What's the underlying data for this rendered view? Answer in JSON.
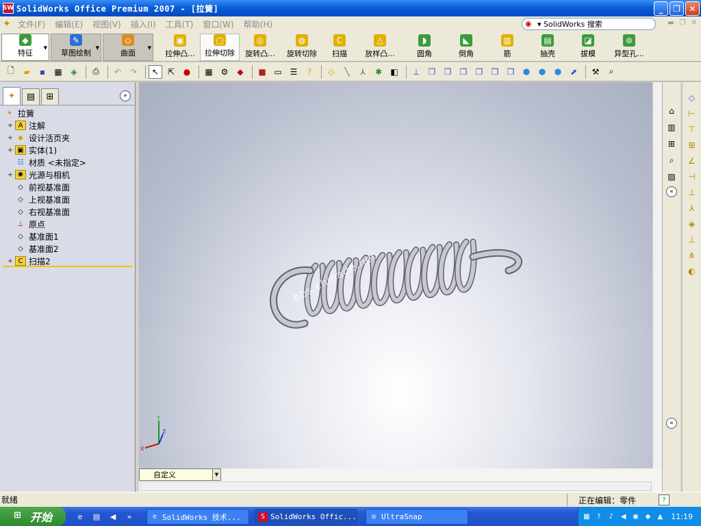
{
  "window": {
    "title": "SolidWorks Office Premium 2007 - [拉簧]",
    "logo_text": "SW",
    "min": "_",
    "restore": "❐",
    "close": "✕"
  },
  "menu": {
    "items": [
      "文件(F)",
      "编辑(E)",
      "视图(V)",
      "插入(I)",
      "工具(T)",
      "窗口(W)",
      "帮助(H)"
    ],
    "search_label": "▾ SolidWorks 搜索"
  },
  "command_manager": {
    "tabs": [
      "特征",
      "草图绘制",
      "曲面"
    ],
    "buttons": [
      "拉伸凸...",
      "拉伸切除",
      "旋转凸...",
      "旋转切除",
      "扫描",
      "放样凸...",
      "圆角",
      "倒角",
      "筋",
      "抽壳",
      "拔模",
      "异型孔..."
    ]
  },
  "feature_tree": {
    "root": "拉簧",
    "items": [
      "注解",
      "设计活页夹",
      "实体(1)",
      "材质 <未指定>",
      "光源与相机",
      "前视基准面",
      "上视基准面",
      "右视基准面",
      "原点",
      "基准面1",
      "基准面2",
      "扫描2"
    ]
  },
  "viewport": {
    "watermark": "bbs.chinade.net",
    "axis_x": "X",
    "axis_y": "Y",
    "axis_z": "Z",
    "configuration": "自定义",
    "background_colors": [
      "#ffffff",
      "#a8afc2"
    ],
    "spring_color": "#c8c8d0"
  },
  "status": {
    "left": "就绪",
    "editing": "正在编辑：零件",
    "help": "?"
  },
  "taskbar": {
    "start": "开始",
    "tasks": [
      "SolidWorks 技术...",
      "SolidWorks Offic...",
      "UltraSnap"
    ],
    "clock": "11:19"
  }
}
